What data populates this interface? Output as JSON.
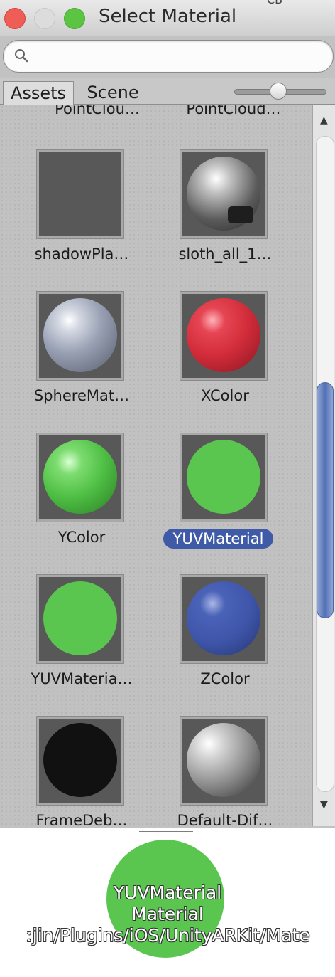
{
  "window": {
    "title": "Select Material",
    "extra_fragment": "CB"
  },
  "search": {
    "placeholder": "",
    "value": ""
  },
  "tabs": [
    {
      "label": "Assets",
      "selected": true
    },
    {
      "label": "Scene",
      "selected": false
    }
  ],
  "zoom_slider": {
    "level": 0.45
  },
  "items": [
    {
      "label": "PointClou…",
      "thumb": "none"
    },
    {
      "label": "PointCloud…",
      "thumb": "none"
    },
    {
      "label": "shadowPla…",
      "thumb": "flat-gray",
      "color": "#585858"
    },
    {
      "label": "sloth_all_1…",
      "thumb": "textured-sphere",
      "color": "#bdbdbd"
    },
    {
      "label": "SphereMat…",
      "thumb": "shaded-sphere",
      "color": "#a7aebd"
    },
    {
      "label": "XColor",
      "thumb": "shaded-sphere",
      "color": "#dd3846"
    },
    {
      "label": "YColor",
      "thumb": "shaded-sphere",
      "color": "#58c24d"
    },
    {
      "label": "YUVMaterial",
      "thumb": "flat-sphere",
      "color": "#5ac650",
      "selected": true
    },
    {
      "label": "YUVMateria…",
      "thumb": "flat-sphere",
      "color": "#5ac650"
    },
    {
      "label": "ZColor",
      "thumb": "shaded-sphere",
      "color": "#3e55a8"
    },
    {
      "label": "FrameDeb…",
      "thumb": "flat-sphere",
      "color": "#111111"
    },
    {
      "label": "Default-Dif…",
      "thumb": "shaded-sphere",
      "color": "#b8b8b8"
    }
  ],
  "scrollbar": {
    "position": 0.48,
    "visible_fraction": 0.35
  },
  "preview": {
    "name": "YUVMaterial",
    "type": "Material",
    "path": "ːjin/Plugins/iOS/UnityARKit/Mate",
    "color": "#5ac650"
  }
}
